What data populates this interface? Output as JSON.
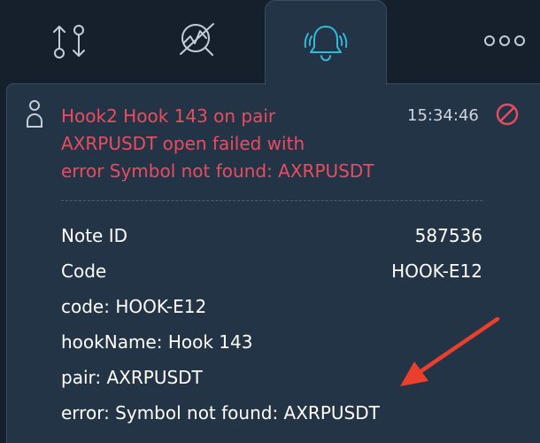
{
  "tabs": {
    "sort_icon": "sort-arrows-icon",
    "chart_icon": "chart-search-icon",
    "alerts_icon": "bell-ringing-icon",
    "more_icon": "more-dots-icon",
    "active": "alerts"
  },
  "notification": {
    "title_lines": [
      "Hook2 Hook 143 on pair",
      "AXRPUSDT open failed with",
      "error Symbol not found: AXRPUSDT"
    ],
    "time": "15:34:46",
    "details": [
      {
        "label": "Note ID",
        "value": "587536"
      },
      {
        "label": "Code",
        "value": "HOOK-E12"
      }
    ],
    "lines": [
      "code: HOOK-E12",
      "hookName: Hook 143",
      "pair: AXRPUSDT",
      "error: Symbol not found: AXRPUSDT"
    ]
  },
  "colors": {
    "background": "#16202d",
    "panel": "#243447",
    "error_text": "#ea4c5f",
    "accent": "#35b9d6",
    "annotation_arrow": "#e8402c"
  }
}
